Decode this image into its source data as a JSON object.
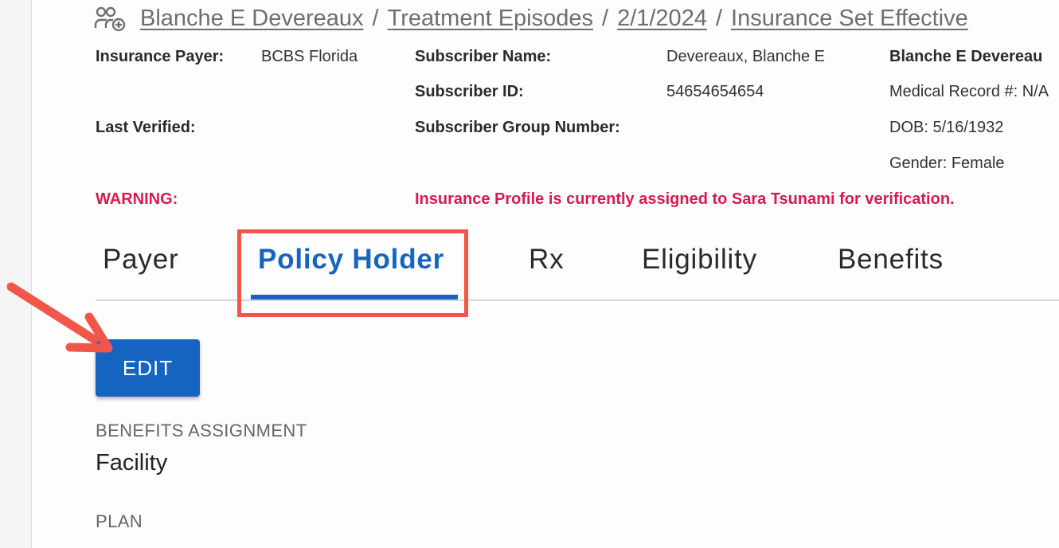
{
  "breadcrumb": {
    "icon": "patient-add-icon",
    "items": [
      "Blanche E Devereaux",
      "Treatment Episodes",
      "2/1/2024",
      "Insurance Set Effective"
    ],
    "separator": "/"
  },
  "info": {
    "insurance_payer_label": "Insurance Payer:",
    "insurance_payer_value": "BCBS Florida",
    "last_verified_label": "Last Verified:",
    "subscriber_name_label": "Subscriber Name:",
    "subscriber_name_value": "Devereaux, Blanche E",
    "subscriber_id_label": "Subscriber ID:",
    "subscriber_id_value": "54654654654",
    "subscriber_group_label": "Subscriber Group Number:",
    "patient_name": "Blanche E Devereau",
    "medical_record": "Medical Record #: N/A",
    "dob": "DOB: 5/16/1932",
    "gender": "Gender: Female",
    "warning_label": "WARNING:",
    "warning_message": "Insurance Profile is currently assigned to Sara Tsunami for verification."
  },
  "tabs": [
    {
      "label": "Payer",
      "active": false
    },
    {
      "label": "Policy Holder",
      "active": true
    },
    {
      "label": "Rx",
      "active": false
    },
    {
      "label": "Eligibility",
      "active": false
    },
    {
      "label": "Benefits",
      "active": false
    }
  ],
  "actions": {
    "edit_label": "EDIT"
  },
  "sections": {
    "benefits_assignment_label": "BENEFITS ASSIGNMENT",
    "benefits_assignment_value": "Facility",
    "plan_label": "PLAN"
  },
  "colors": {
    "accent": "#1565c0",
    "warning": "#d81b4f",
    "annotation": "#f0564a"
  }
}
